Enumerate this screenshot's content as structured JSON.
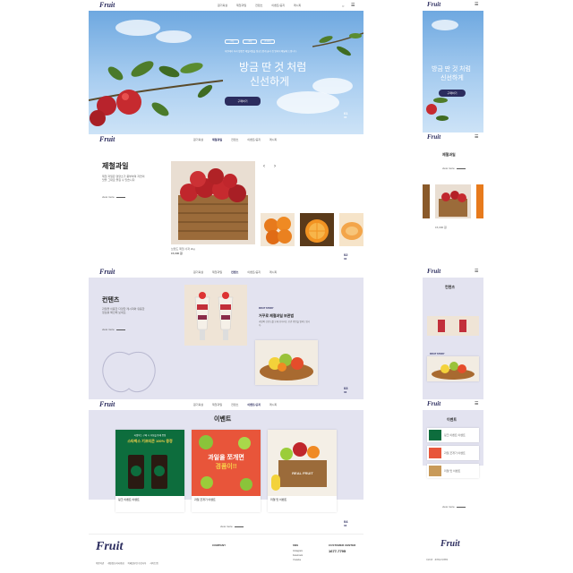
{
  "brand": {
    "logo": "Fruit",
    "small_caption": "WELL-BEING"
  },
  "nav": {
    "items": [
      "원기획설",
      "제철과일",
      "컨텐츠",
      "이벤트/공지",
      "레시피"
    ]
  },
  "hero": {
    "tags": [
      "#과일",
      "#제철",
      "#추천과일"
    ],
    "subcopy": "자연에서 자라 맛좋은 제철과일을 정성스럽게 골라 집 앞까지 배달해 드립니다.",
    "headline_line1": "방금 딴 것 처럼",
    "headline_line2": "신선하게",
    "cta": "구매하기",
    "pager": "01",
    "pager_total": "04"
  },
  "seasonal": {
    "title": "제철과일",
    "desc": "제철 과일은 영양소가 풍부하며 자연의 맛을 그대로 즐길 수 있습니다.",
    "more": "view more",
    "caption_name": "브랜드 제철 사과 2kg",
    "caption_price": "15,000 원",
    "pager": "02",
    "pager_total": "04"
  },
  "contents": {
    "title": "컨텐츠",
    "desc": "과일을 이용한 다양한 레시피와 유용한 정보를 확인해 보세요.",
    "more": "view more",
    "story_label": "FRUIT STORY",
    "story_title": "거꾸로 제철과일 보관법",
    "story_desc": "과일의 신선도를 오래 유지하는 보관 방법을 알려드립니다.",
    "pager": "03",
    "pager_total": "04"
  },
  "event": {
    "title": "이벤트",
    "banner1_top": "과일박스 구매 시 추첨을 통해 증정",
    "banner1_big": "스타벅스 기프티콘 100% 증정",
    "banner2_big_line1": "과일을 쪼개면",
    "banner2_big_line2": "경품이!!",
    "banner3_text": "REAL FRUIT",
    "card_titles": [
      "링크 이벤트 이벤트",
      "과일 쪼개기 이벤트",
      "리얼 맛 이벤트"
    ],
    "more": "view more",
    "pager": "04",
    "pager_total": "04"
  },
  "footer": {
    "col1_title": "COMPANY",
    "col2_title": "SNS",
    "col3_title": "CUSTOMER CENTER",
    "phone": "1677-7795",
    "links": [
      "이용약관",
      "개인정보처리방침",
      "이메일무단수집거부",
      "사이트맵"
    ],
    "sns": [
      "Instagram",
      "Facebook",
      "Youtube"
    ]
  },
  "colors": {
    "primary": "#2b2c5e",
    "lavender": "#e3e3f0",
    "sky": "#8dbde8"
  }
}
